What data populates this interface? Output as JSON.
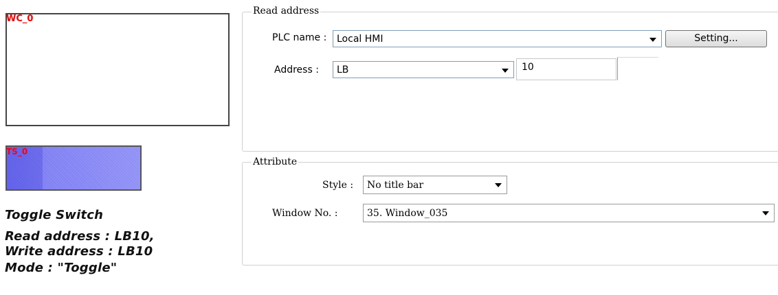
{
  "preview": {
    "window_object_label": "WC_0",
    "toggle_switch_label": "TS_0",
    "description": [
      "Toggle Switch",
      "Read address : LB10,",
      "Write address : LB10",
      "Mode : \"Toggle\""
    ]
  },
  "read_address": {
    "title": "Read address",
    "plc_name_label": "PLC name :",
    "plc_name_value": "Local HMI",
    "setting_button": "Setting...",
    "address_label": "Address :",
    "address_type": "LB",
    "address_value": "10"
  },
  "attribute": {
    "title": "Attribute",
    "style_label": "Style :",
    "style_value": "No title bar",
    "window_no_label": "Window No. :",
    "window_no_value": "35. Window_035"
  }
}
